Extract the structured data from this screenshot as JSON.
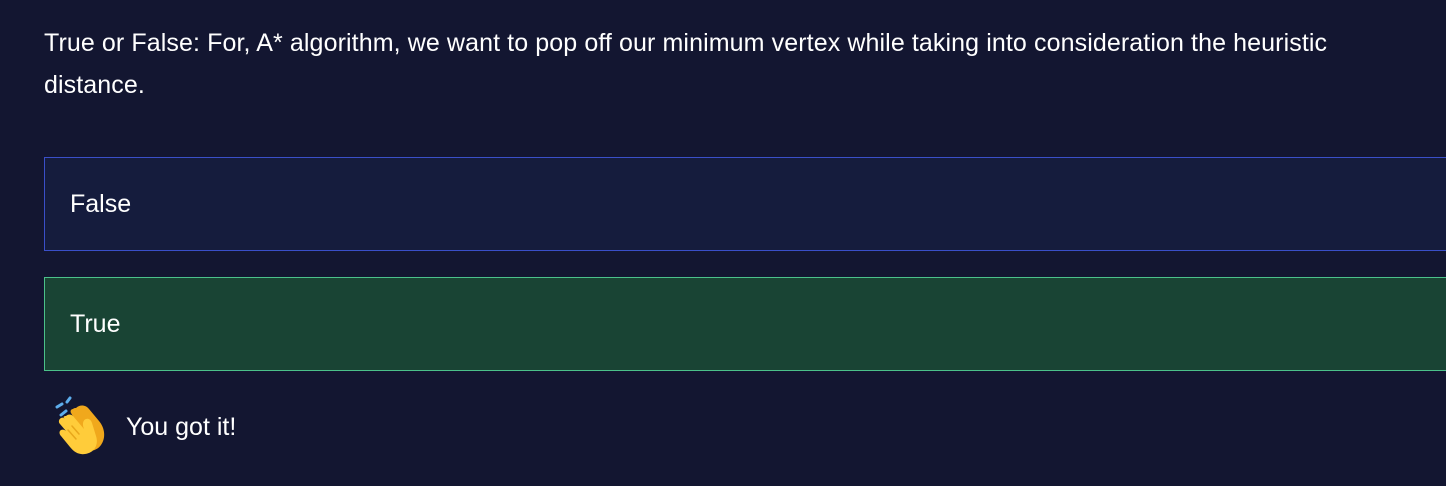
{
  "question": {
    "text": "True or False: For, A* algorithm, we want to pop off our minimum vertex while taking into consideration the heuristic distance."
  },
  "options": [
    {
      "label": "False",
      "state": "unselected"
    },
    {
      "label": "True",
      "state": "correct"
    }
  ],
  "feedback": {
    "icon": "clapping-hands-icon",
    "text": "You got it!"
  },
  "colors": {
    "background": "#131631",
    "option_bg": "#151c3d",
    "option_border": "#3a4fc8",
    "correct_bg": "#194434",
    "correct_border": "#4bc18a"
  }
}
